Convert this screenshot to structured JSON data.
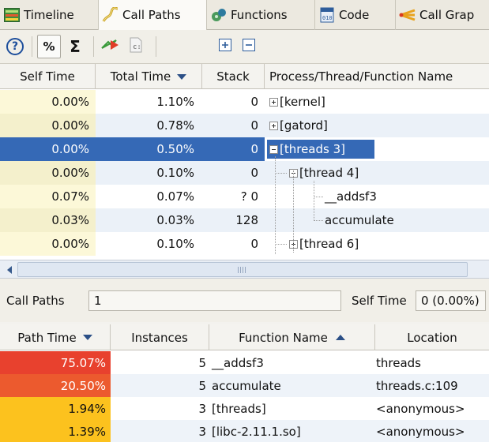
{
  "tabs": [
    {
      "label": "Timeline",
      "icon": "timeline-icon"
    },
    {
      "label": "Call Paths",
      "icon": "call-paths-icon"
    },
    {
      "label": "Functions",
      "icon": "functions-icon"
    },
    {
      "label": "Code",
      "icon": "code-icon"
    },
    {
      "label": "Call Grap",
      "icon": "call-graph-icon"
    }
  ],
  "toolbar": {
    "help": "?",
    "percent": "%",
    "sigma": "Σ"
  },
  "upper_table": {
    "headers": [
      "Self Time",
      "Total Time",
      "Stack",
      "Process/Thread/Function Name"
    ],
    "rows": [
      {
        "self": "0.00%",
        "total": "1.10%",
        "stack": "0",
        "name": "[kernel]"
      },
      {
        "self": "0.00%",
        "total": "0.78%",
        "stack": "0",
        "name": "[gatord]"
      },
      {
        "self": "0.00%",
        "total": "0.50%",
        "stack": "0",
        "name": "[threads 3]"
      },
      {
        "self": "0.00%",
        "total": "0.10%",
        "stack": "0",
        "name": "[thread 4]"
      },
      {
        "self": "0.07%",
        "total": "0.07%",
        "stack": "? 0",
        "name": "__addsf3"
      },
      {
        "self": "0.03%",
        "total": "0.03%",
        "stack": "128",
        "name": "accumulate"
      },
      {
        "self": "0.00%",
        "total": "0.10%",
        "stack": "0",
        "name": "[thread 6]"
      }
    ]
  },
  "info": {
    "call_paths_label": "Call Paths",
    "call_paths_value": "1",
    "self_time_label": "Self Time",
    "self_time_value": "0 (0.00%)"
  },
  "lower_table": {
    "headers": [
      "Path Time",
      "Instances",
      "Function Name",
      "Location"
    ],
    "rows": [
      {
        "path": "75.07%",
        "instances": "5",
        "func": "__addsf3",
        "loc": "threads",
        "color": "#e8412e"
      },
      {
        "path": "20.50%",
        "instances": "5",
        "func": "accumulate",
        "loc": "threads.c:109",
        "color": "#ec5a2e"
      },
      {
        "path": "1.94%",
        "instances": "3",
        "func": "[threads]",
        "loc": "<anonymous>",
        "color": "#fcc21e"
      },
      {
        "path": "1.39%",
        "instances": "3",
        "func": "[libc-2.11.1.so]",
        "loc": "<anonymous>",
        "color": "#fcc21e"
      }
    ]
  },
  "colors": {
    "selection": "#3569b6",
    "self_time_bg": "#fcf8d8",
    "hot": "#e8412e",
    "warm": "#fcc21e"
  }
}
